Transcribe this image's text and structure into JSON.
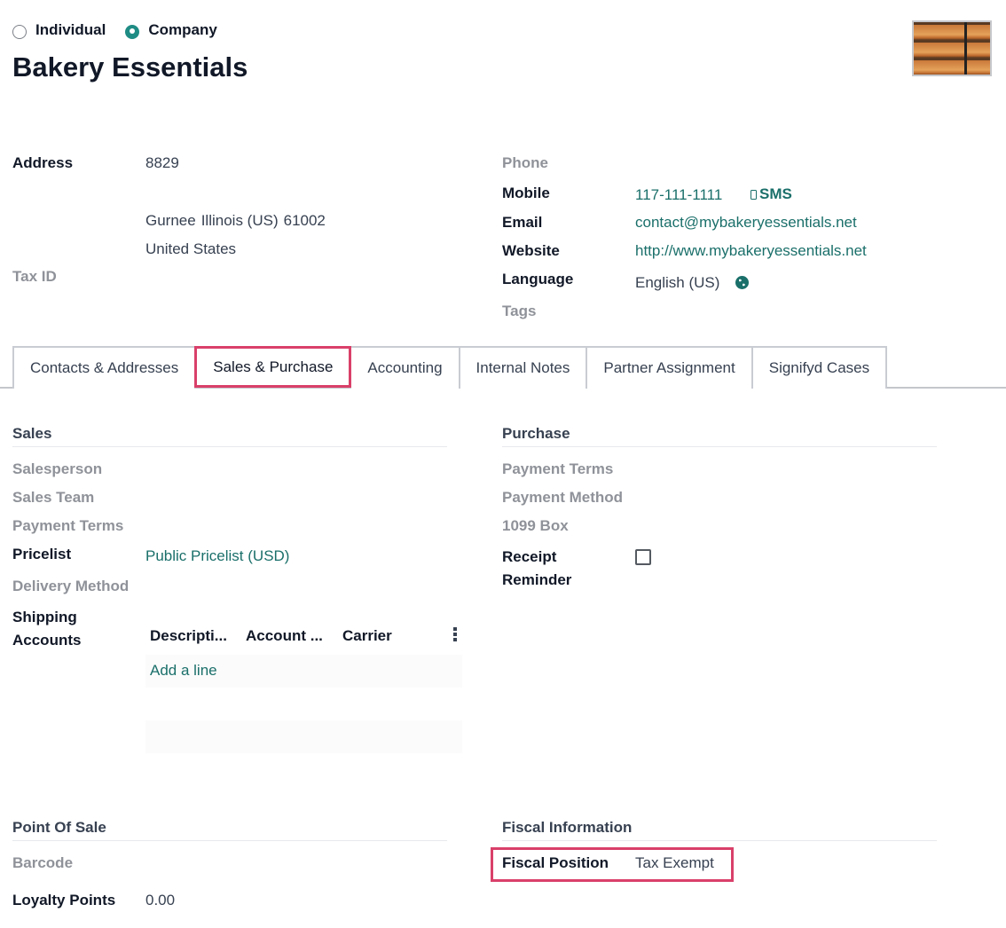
{
  "partner_type": {
    "options": [
      {
        "label": "Individual",
        "checked": false
      },
      {
        "label": "Company",
        "checked": true
      }
    ]
  },
  "title": "Bakery Essentials",
  "avatar": {
    "alt": "bakery-display-photo"
  },
  "address": {
    "label": "Address",
    "street": "8829",
    "city": "Gurnee",
    "state": "Illinois (US)",
    "zip": "61002",
    "country": "United States"
  },
  "tax_id": {
    "label": "Tax ID",
    "value": ""
  },
  "contact": {
    "phone": {
      "label": "Phone",
      "value": ""
    },
    "mobile": {
      "label": "Mobile",
      "value": "117-111-1111",
      "sms_label": "SMS"
    },
    "email": {
      "label": "Email",
      "value": "contact@mybakeryessentials.net"
    },
    "website": {
      "label": "Website",
      "value": "http://www.mybakeryessentials.net"
    },
    "language": {
      "label": "Language",
      "value": "English (US)"
    },
    "tags": {
      "label": "Tags",
      "value": ""
    }
  },
  "tabs": [
    {
      "label": "Contacts & Addresses",
      "active": false
    },
    {
      "label": "Sales & Purchase",
      "active": true
    },
    {
      "label": "Accounting",
      "active": false
    },
    {
      "label": "Internal Notes",
      "active": false
    },
    {
      "label": "Partner Assignment",
      "active": false
    },
    {
      "label": "Signifyd Cases",
      "active": false
    }
  ],
  "sales": {
    "heading": "Sales",
    "salesperson": "Salesperson",
    "sales_team": "Sales Team",
    "payment_terms": "Payment Terms",
    "pricelist": {
      "label": "Pricelist",
      "value": "Public Pricelist (USD)"
    },
    "delivery_method": "Delivery Method",
    "shipping_accounts": {
      "label_line1": "Shipping",
      "label_line2": "Accounts",
      "columns": [
        "Descripti...",
        "Account ...",
        "Carrier"
      ],
      "add_line": "Add a line"
    }
  },
  "purchase": {
    "heading": "Purchase",
    "payment_terms": "Payment Terms",
    "payment_method": "Payment Method",
    "box_1099": "1099 Box",
    "receipt_reminder": {
      "label_line1": "Receipt",
      "label_line2": "Reminder",
      "checked": false
    }
  },
  "pos": {
    "heading": "Point Of Sale",
    "barcode": "Barcode",
    "loyalty": {
      "label": "Loyalty Points",
      "value": "0.00"
    }
  },
  "fiscal": {
    "heading": "Fiscal Information",
    "position": {
      "label": "Fiscal Position",
      "value": "Tax Exempt"
    }
  },
  "colors": {
    "accent": "#1a6f6a",
    "highlight": "#d9406a"
  }
}
